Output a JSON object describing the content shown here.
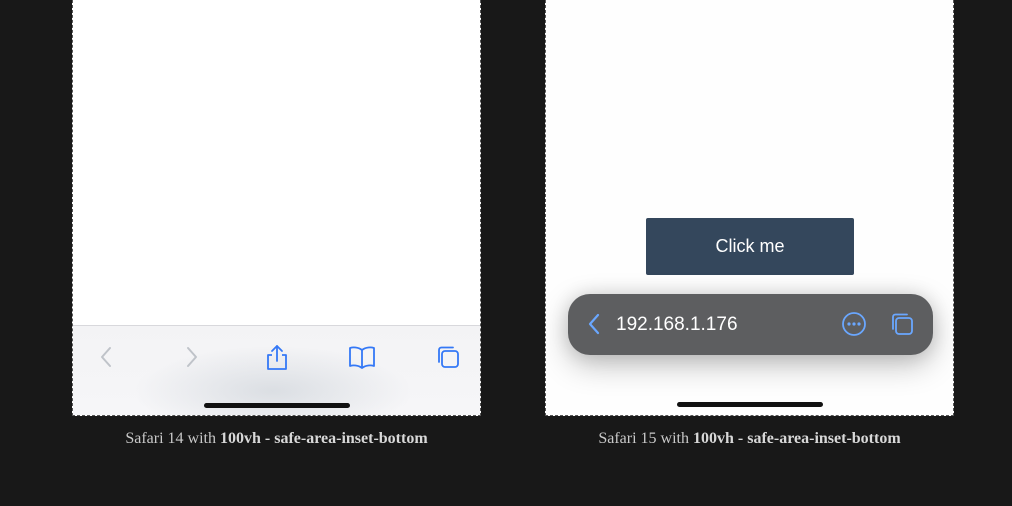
{
  "left_panel": {
    "caption_prefix": "Safari 14 with ",
    "caption_bold": "100vh - safe-area-inset-bottom",
    "toolbar": {
      "back_icon": "chevron-left-icon",
      "forward_icon": "chevron-right-icon",
      "share_icon": "share-icon",
      "bookmarks_icon": "book-icon",
      "tabs_icon": "tabs-icon"
    }
  },
  "right_panel": {
    "caption_prefix": "Safari 15 with ",
    "caption_bold": "100vh - safe-area-inset-bottom",
    "button_label": "Click me",
    "address_bar": {
      "url": "192.168.1.176",
      "back_icon": "chevron-left-icon",
      "more_icon": "more-icon",
      "tabs_icon": "tabs-icon"
    }
  },
  "colors": {
    "background": "#181818",
    "button_bg": "#34475c",
    "address_bar_bg": "#5d5e60",
    "accent_blue": "#3478f6",
    "accent_blue_light": "#6aa7ff"
  }
}
